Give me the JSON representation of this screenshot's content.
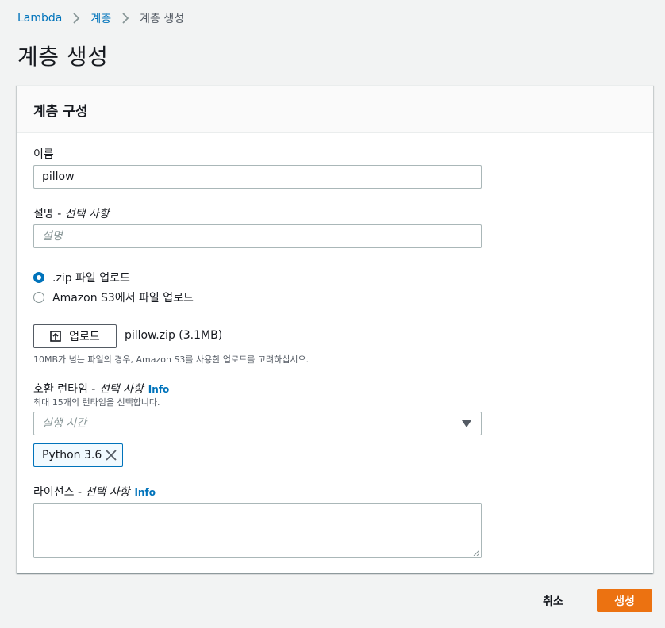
{
  "breadcrumb": {
    "items": [
      "Lambda",
      "계층",
      "계층 생성"
    ]
  },
  "page": {
    "title": "계층 생성"
  },
  "panel": {
    "title": "계층 구성",
    "name": {
      "label": "이름",
      "value": "pillow"
    },
    "description": {
      "label": "설명 - ",
      "optional": "선택 사항",
      "placeholder": "설명"
    },
    "upload_options": [
      {
        "label": ".zip 파일 업로드",
        "selected": true
      },
      {
        "label": "Amazon S3에서 파일 업로드",
        "selected": false
      }
    ],
    "upload_button": "업로드",
    "file_name": "pillow.zip (3.1MB)",
    "upload_hint": "10MB가 넘는 파일의 경우, Amazon S3를 사용한 업로드를 고려하십시오.",
    "runtimes": {
      "label": "호환 런타임 - ",
      "optional": "선택 사항",
      "info": "Info",
      "hint": "최대 15개의 런타임을 선택합니다.",
      "placeholder": "실행 시간",
      "selected": [
        "Python 3.6"
      ]
    },
    "license": {
      "label": "라이선스 - ",
      "optional": "선택 사항",
      "info": "Info",
      "value": ""
    }
  },
  "footer": {
    "cancel_label": "취소",
    "create_label": "생성"
  },
  "colors": {
    "link": "#0073bb",
    "primary": "#ec7211",
    "background": "#f2f3f3"
  }
}
